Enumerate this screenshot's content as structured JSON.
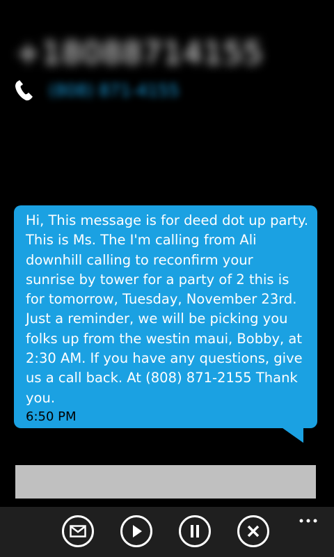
{
  "header": {
    "contact_name": "+18088714155",
    "phone_number": "(808) 871-4155",
    "phone_icon": "phone-icon"
  },
  "message": {
    "text": "Hi, This message is for deed dot up party.\nThis is Ms. The I'm calling from Ali\ndownhill calling to reconfirm your\nsunrise by tower for a party of 2 this is\nfor tomorrow, Tuesday, November 23rd.\nJust a reminder, we will be picking you\nfolks up from the westin maui, Bobby, at\n2:30 AM. If you have any questions, give\nus a call back. At (808) 871-2155 Thank\nyou.",
    "time": "6:50 PM"
  },
  "reply": {
    "value": ""
  },
  "app_bar": {
    "buttons": [
      {
        "icon": "envelope-icon"
      },
      {
        "icon": "play-icon"
      },
      {
        "icon": "pause-icon"
      },
      {
        "icon": "close-icon"
      }
    ],
    "more_icon": "more-dots-icon"
  },
  "colors": {
    "accent": "#1ba1e2",
    "background": "#000000",
    "app_bar": "#1f1f1f",
    "reply_box": "#c0c0c0"
  }
}
